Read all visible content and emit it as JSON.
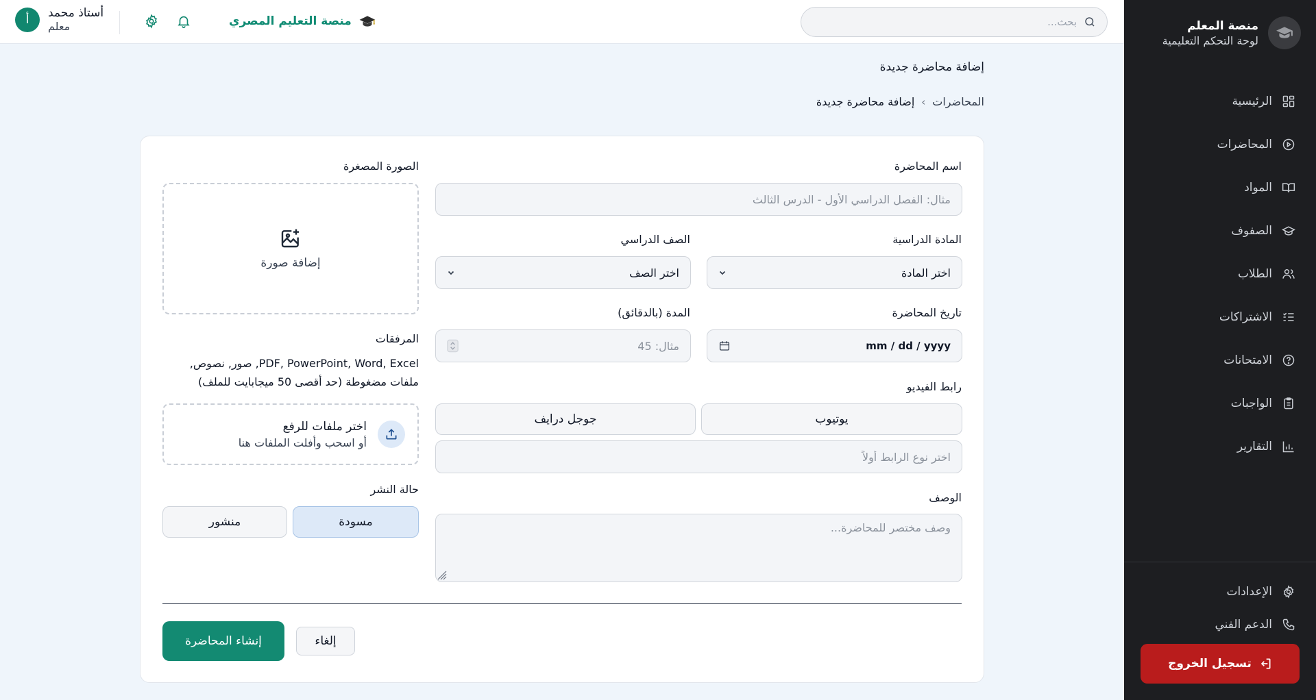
{
  "colors": {
    "accent": "#138a72",
    "sidebar_bg": "#1d1e21",
    "logout_bg": "#b91c1c",
    "active_toggle": "#dde9f8"
  },
  "sidebar": {
    "brand_title": "منصة المعلم",
    "brand_subtitle": "لوحة التحكم التعليمية",
    "logo_icon": "graduation-cap-icon",
    "items": [
      {
        "label": "الرئيسية",
        "icon": "dashboard-grid-icon"
      },
      {
        "label": "المحاضرات",
        "icon": "play-circle-icon"
      },
      {
        "label": "المواد",
        "icon": "book-open-icon"
      },
      {
        "label": "الصفوف",
        "icon": "graduation-cap-icon"
      },
      {
        "label": "الطلاب",
        "icon": "users-icon"
      },
      {
        "label": "الاشتراكات",
        "icon": "list-check-icon"
      },
      {
        "label": "الامتحانات",
        "icon": "help-circle-icon"
      },
      {
        "label": "الواجبات",
        "icon": "clipboard-icon"
      },
      {
        "label": "التقارير",
        "icon": "bar-chart-icon"
      }
    ],
    "bottom_items": [
      {
        "label": "الإعدادات",
        "icon": "gear-icon"
      },
      {
        "label": "الدعم الفني",
        "icon": "phone-icon"
      }
    ],
    "logout_label": "تسجيل الخروج"
  },
  "topbar": {
    "search_placeholder": "بحث...",
    "brand": "منصة التعليم المصري",
    "user_name": "أستاذ محمد",
    "user_role": "معلم",
    "avatar_initial": "أ"
  },
  "page": {
    "title": "إضافة محاضرة جديدة",
    "breadcrumb": [
      "المحاضرات",
      "إضافة محاضرة جديدة"
    ]
  },
  "form": {
    "name_label": "اسم المحاضرة",
    "name_placeholder": "مثال: الفصل الدراسي الأول - الدرس الثالث",
    "subject_label": "المادة الدراسية",
    "subject_value": "اختر المادة",
    "grade_label": "الصف الدراسي",
    "grade_value": "اختر الصف",
    "date_label": "تاريخ المحاضرة",
    "date_value": "mm / dd / yyyy",
    "duration_label": "المدة (بالدقائق)",
    "duration_placeholder": "مثال: 45",
    "video_label": "رابط الفيديو",
    "video_options": [
      "يوتيوب",
      "جوجل درايف"
    ],
    "video_placeholder": "اختر نوع الرابط أولاً",
    "description_label": "الوصف",
    "description_placeholder": "وصف مختصر للمحاضرة...",
    "thumbnail_label": "الصورة المصغرة",
    "thumbnail_add": "إضافة صورة",
    "attachments_label": "المرفقات",
    "attachments_hint": "PDF, PowerPoint, Word, Excel, صور, نصوص, ملفات مضغوطة (حد أقصى 50 ميجابايت للملف)",
    "upload_title": "اختر ملفات للرفع",
    "upload_sub": "أو اسحب وأفلت الملفات هنا",
    "publish_label": "حالة النشر",
    "publish_options": [
      "مسودة",
      "منشور"
    ],
    "publish_selected": "مسودة",
    "submit_label": "إنشاء المحاضرة",
    "cancel_label": "إلغاء"
  }
}
